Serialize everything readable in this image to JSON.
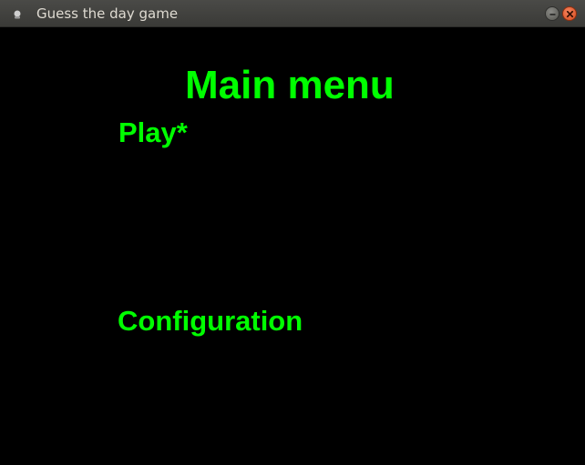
{
  "window": {
    "title": "Guess the day game",
    "icons": {
      "app": "app-icon",
      "minimize": "minimize-icon",
      "close": "close-icon"
    }
  },
  "menu": {
    "title": "Main menu",
    "items": [
      {
        "label": "Play*",
        "selected": true
      },
      {
        "label": "Configuration",
        "selected": false
      }
    ]
  },
  "colors": {
    "background": "#000000",
    "text": "#00ff00",
    "titlebar": "#3c3b37",
    "close_button": "#e0582b"
  }
}
